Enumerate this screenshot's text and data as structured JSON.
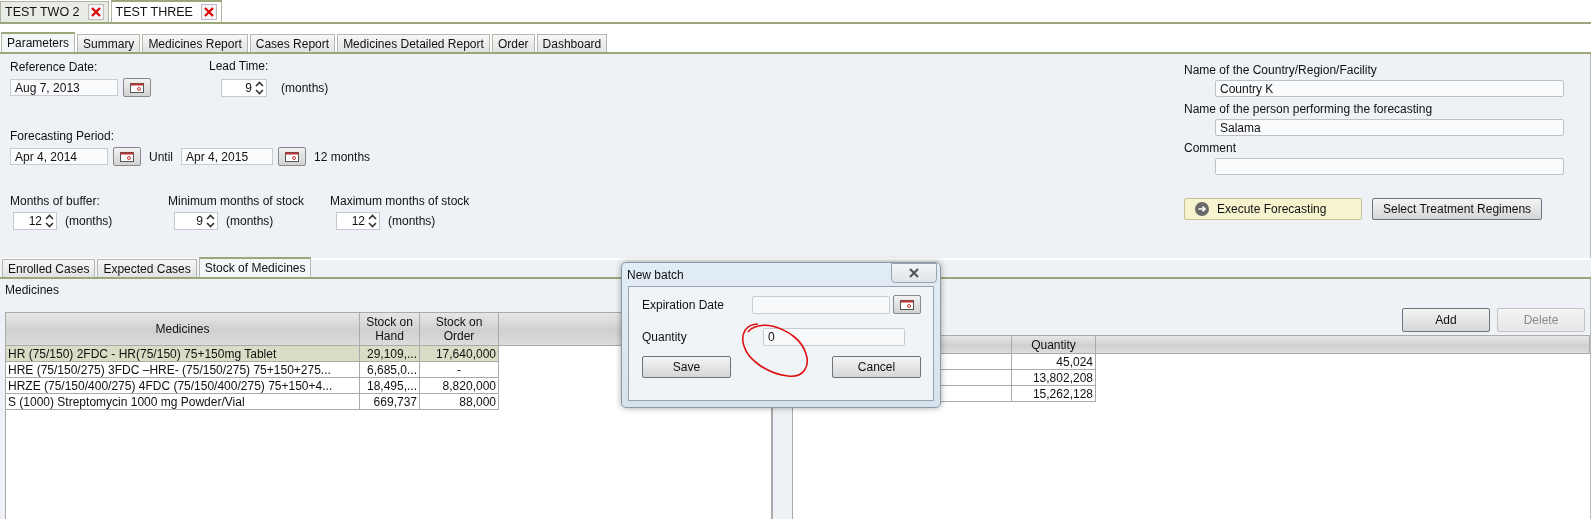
{
  "document_tabs": [
    {
      "label": "TEST TWO 2",
      "selected": false
    },
    {
      "label": "TEST THREE",
      "selected": true
    }
  ],
  "tabs": [
    {
      "label": "Parameters",
      "selected": true
    },
    {
      "label": "Summary",
      "selected": false
    },
    {
      "label": "Medicines Report",
      "selected": false
    },
    {
      "label": "Cases Report",
      "selected": false
    },
    {
      "label": "Medicines Detailed Report",
      "selected": false
    },
    {
      "label": "Order",
      "selected": false
    },
    {
      "label": "Dashboard",
      "selected": false
    }
  ],
  "parameters": {
    "reference_date": {
      "label": "Reference Date:",
      "value": "Aug 7, 2013"
    },
    "lead_time": {
      "label": "Lead Time:",
      "value": "9",
      "unit": "(months)"
    },
    "forecasting_period": {
      "label": "Forecasting Period:",
      "start": "Apr 4, 2014",
      "until": "Until",
      "end": "Apr 4, 2015",
      "duration": "12 months"
    },
    "stock_settings": [
      {
        "label": "Months of buffer:",
        "value": "12",
        "unit": "(months)"
      },
      {
        "label": "Minimum months of stock",
        "value": "9",
        "unit": "(months)"
      },
      {
        "label": "Maximum months of stock",
        "value": "12",
        "unit": "(months)"
      }
    ]
  },
  "facility": {
    "fields": [
      {
        "label": "Name of the Country/Region/Facility",
        "value": "Country K"
      },
      {
        "label": "Name of the person performing the forecasting",
        "value": "Salama"
      },
      {
        "label": "Comment"
      }
    ],
    "buttons": [
      {
        "label": "Execute Forecasting",
        "kind": "primary"
      },
      {
        "label": "Select Treatment Regimens",
        "kind": "default"
      }
    ]
  },
  "sub_tabs": [
    {
      "label": "Enrolled Cases",
      "selected": false
    },
    {
      "label": "Expected Cases",
      "selected": false
    },
    {
      "label": "Stock of Medicines",
      "selected": true
    }
  ],
  "medicines_panel": {
    "title": "Medicines",
    "columns": [
      "Medicines",
      "Stock on Hand",
      "Stock on Order"
    ],
    "rows": [
      {
        "cells": [
          "HR (75/150)  2FDC - HR(75/150)  75+150mg  Tablet",
          "29,109,...",
          "17,640,000"
        ],
        "selected": true
      },
      {
        "cells": [
          "HRE (75/150/275)  3FDC –HRE- (75/150/275)  75+150+275...",
          "6,685,0...",
          "-"
        ],
        "selected": false
      },
      {
        "cells": [
          "HRZE (75/150/400/275)  4FDC (75/150/400/275)  75+150+4...",
          "18,495,...",
          "8,820,000"
        ],
        "selected": false
      },
      {
        "cells": [
          "S (1000)  Streptomycin  1000 mg  Powder/Vial",
          "669,737",
          "88,000"
        ],
        "selected": false
      }
    ]
  },
  "batch_panel": {
    "buttons": [
      {
        "label": "Add",
        "disabled": false
      },
      {
        "label": "Delete",
        "disabled": true
      }
    ],
    "quantity_column": "Quantity",
    "rows": [
      {
        "quantity": "45,024"
      },
      {
        "quantity": "13,802,208"
      },
      {
        "quantity": "15,262,128"
      }
    ]
  },
  "dialog": {
    "title": "New batch",
    "fields": [
      {
        "label": "Expiration Date",
        "kind": "date"
      },
      {
        "label": "Quantity",
        "kind": "text",
        "value": "0"
      }
    ],
    "buttons": [
      "Save",
      "Cancel"
    ]
  }
}
